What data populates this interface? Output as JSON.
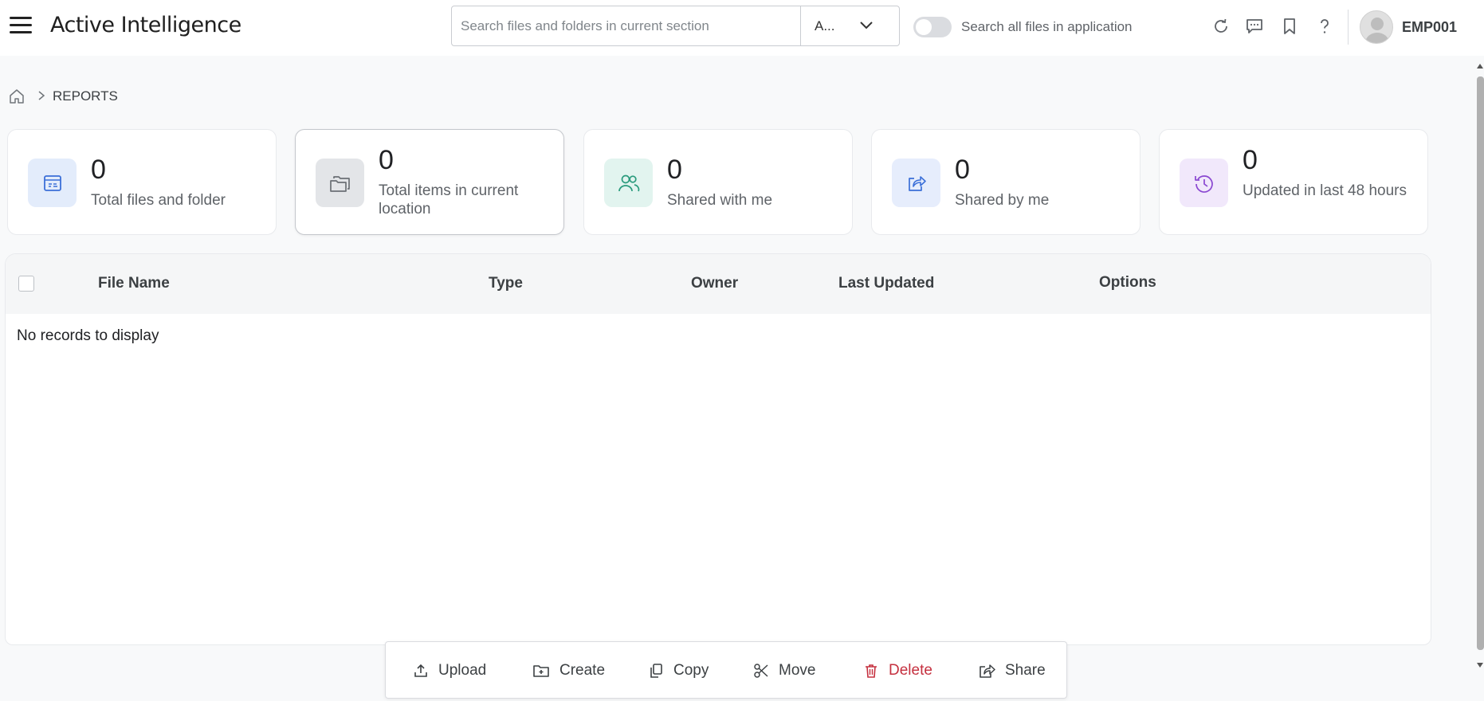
{
  "header": {
    "title": "Active Intelligence",
    "search_placeholder": "Search files and folders in current section",
    "scope_value": "A...",
    "toggle_label": "Search all files in application",
    "user_name": "EMP001"
  },
  "breadcrumb": {
    "current": "REPORTS"
  },
  "cards": [
    {
      "value": "0",
      "label": "Total files and folder",
      "color": "#e3ecfb",
      "icon": "file-table-icon"
    },
    {
      "value": "0",
      "label": "Total items in current location",
      "color": "#e3e5e8",
      "icon": "folders-icon"
    },
    {
      "value": "0",
      "label": "Shared with me",
      "color": "#e2f4ef",
      "icon": "users-icon"
    },
    {
      "value": "0",
      "label": "Shared by me",
      "color": "#e6edfc",
      "icon": "share-out-icon"
    },
    {
      "value": "0",
      "label": "Updated in last 48 hours",
      "color": "#f1e8fb",
      "icon": "history-icon"
    }
  ],
  "table": {
    "columns": [
      "File Name",
      "Type",
      "Owner",
      "Last Updated",
      "Options"
    ],
    "empty_message": "No records to display"
  },
  "actions": {
    "upload": "Upload",
    "create": "Create",
    "copy": "Copy",
    "move": "Move",
    "delete": "Delete",
    "share": "Share"
  },
  "colors": {
    "danger": "#c5303f",
    "background": "#f8f9fa"
  }
}
